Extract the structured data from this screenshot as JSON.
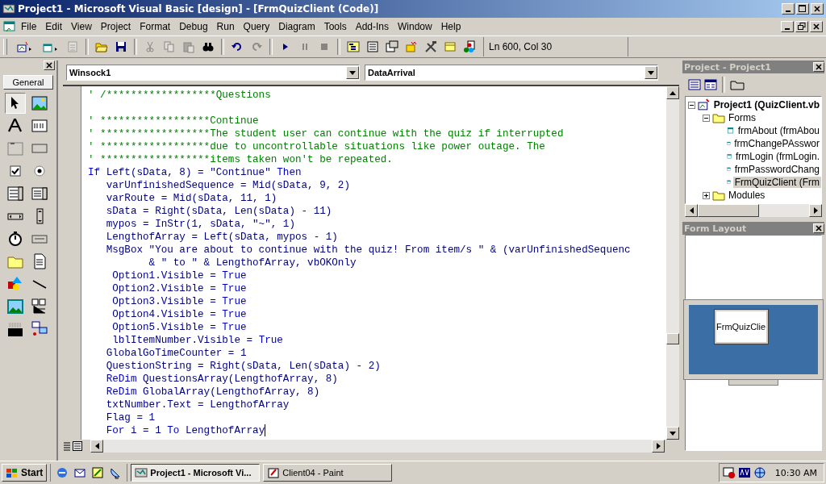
{
  "window": {
    "title": "Project1 - Microsoft Visual Basic [design] - [FrmQuizClient (Code)]"
  },
  "menu": [
    "File",
    "Edit",
    "View",
    "Project",
    "Format",
    "Debug",
    "Run",
    "Query",
    "Diagram",
    "Tools",
    "Add-Ins",
    "Window",
    "Help"
  ],
  "toolbar": {
    "buttons": [
      {
        "disabled": false
      },
      {
        "disabled": false
      },
      {
        "disabled": true
      },
      {
        "disabled": false
      },
      {
        "disabled": false
      },
      {
        "disabled": true
      },
      {
        "disabled": true
      },
      {
        "disabled": true
      },
      {
        "disabled": false
      },
      {
        "disabled": false
      },
      {
        "disabled": true
      },
      {
        "disabled": false
      },
      {
        "disabled": true
      },
      {
        "disabled": true
      },
      {
        "disabled": false
      },
      {
        "disabled": false
      },
      {
        "disabled": false
      },
      {
        "disabled": false
      },
      {
        "disabled": false
      },
      {
        "disabled": false
      },
      {
        "disabled": false
      }
    ],
    "position": "Ln 600, Col 30"
  },
  "toolbox": {
    "tab": "General",
    "tools": [
      {
        "selected": true
      },
      {
        "selected": false
      },
      {
        "selected": false
      },
      {
        "selected": false
      },
      {
        "selected": false
      },
      {
        "selected": false
      },
      {
        "selected": false
      },
      {
        "selected": false
      },
      {
        "selected": false
      },
      {
        "selected": false
      },
      {
        "selected": false
      },
      {
        "selected": false
      },
      {
        "selected": false
      },
      {
        "selected": false
      },
      {
        "selected": false
      },
      {
        "selected": false
      },
      {
        "selected": false
      },
      {
        "selected": false
      },
      {
        "selected": false
      },
      {
        "selected": false
      },
      {
        "selected": false
      },
      {
        "selected": false
      }
    ]
  },
  "code": {
    "object": "Winsock1",
    "procedure": "DataArrival",
    "lines": [
      {
        "kind": "code",
        "tokens": [
          {
            "kind": "comment",
            "text": "' /******************Questions"
          }
        ]
      },
      {
        "kind": "blank"
      },
      {
        "kind": "code",
        "tokens": [
          {
            "kind": "comment",
            "text": "' ******************Continue"
          }
        ]
      },
      {
        "kind": "code",
        "tokens": [
          {
            "kind": "comment",
            "text": "' ******************The student user can continue with the quiz if interrupted"
          }
        ]
      },
      {
        "kind": "code",
        "tokens": [
          {
            "kind": "comment",
            "text": "' ******************due to uncontrollable situations like power outage. The"
          }
        ]
      },
      {
        "kind": "code",
        "tokens": [
          {
            "kind": "comment",
            "text": "' ******************items taken won't be repeated."
          }
        ]
      },
      {
        "kind": "code",
        "tokens": [
          {
            "kind": "keyword",
            "text": "If"
          },
          {
            "kind": "plain",
            "text": " Left(sData, 8) = \"Continue\" "
          },
          {
            "kind": "keyword",
            "text": "Then"
          }
        ]
      },
      {
        "kind": "code",
        "tokens": [
          {
            "kind": "plain",
            "text": "   varUnfinishedSequence = Mid(sData, 9, 2)"
          }
        ]
      },
      {
        "kind": "code",
        "tokens": [
          {
            "kind": "plain",
            "text": "   varRoute = Mid(sData, 11, 1)"
          }
        ]
      },
      {
        "kind": "code",
        "tokens": [
          {
            "kind": "plain",
            "text": "   sData = Right(sData, Len(sData) - 11)"
          }
        ]
      },
      {
        "kind": "code",
        "tokens": [
          {
            "kind": "plain",
            "text": "   mypos = InStr(1, sData, \"~\", 1)"
          }
        ]
      },
      {
        "kind": "code",
        "tokens": [
          {
            "kind": "plain",
            "text": "   LengthofArray = Left(sData, mypos - 1)"
          }
        ]
      },
      {
        "kind": "code",
        "tokens": [
          {
            "kind": "plain",
            "text": "   MsgBox \"You are about to continue with the quiz! From item/s \" & (varUnfinishedSequenc"
          }
        ]
      },
      {
        "kind": "code",
        "tokens": [
          {
            "kind": "plain",
            "text": "          & \" to \" & LengthofArray, vbOKOnly"
          }
        ]
      },
      {
        "kind": "code",
        "tokens": [
          {
            "kind": "plain",
            "text": "    Option1.Visible = "
          },
          {
            "kind": "keyword",
            "text": "True"
          }
        ]
      },
      {
        "kind": "code",
        "tokens": [
          {
            "kind": "plain",
            "text": "    Option2.Visible = "
          },
          {
            "kind": "keyword",
            "text": "True"
          }
        ]
      },
      {
        "kind": "code",
        "tokens": [
          {
            "kind": "plain",
            "text": "    Option3.Visible = "
          },
          {
            "kind": "keyword",
            "text": "True"
          }
        ]
      },
      {
        "kind": "code",
        "tokens": [
          {
            "kind": "plain",
            "text": "    Option4.Visible = "
          },
          {
            "kind": "keyword",
            "text": "True"
          }
        ]
      },
      {
        "kind": "code",
        "tokens": [
          {
            "kind": "plain",
            "text": "    Option5.Visible = "
          },
          {
            "kind": "keyword",
            "text": "True"
          }
        ]
      },
      {
        "kind": "code",
        "tokens": [
          {
            "kind": "plain",
            "text": "    lblItemNumber.Visible = "
          },
          {
            "kind": "keyword",
            "text": "True"
          }
        ]
      },
      {
        "kind": "code",
        "tokens": [
          {
            "kind": "plain",
            "text": "   GlobalGoTimeCounter = 1"
          }
        ]
      },
      {
        "kind": "code",
        "tokens": [
          {
            "kind": "plain",
            "text": "   QuestionString = Right(sData, Len(sData) - 2)"
          }
        ]
      },
      {
        "kind": "code",
        "tokens": [
          {
            "kind": "keyword",
            "text": "   ReDim"
          },
          {
            "kind": "plain",
            "text": " QuestionsArray(LengthofArray, 8)"
          }
        ]
      },
      {
        "kind": "code",
        "tokens": [
          {
            "kind": "keyword",
            "text": "   ReDim"
          },
          {
            "kind": "plain",
            "text": " GlobalArray(LengthofArray, 8)"
          }
        ]
      },
      {
        "kind": "code",
        "tokens": [
          {
            "kind": "plain",
            "text": "   txtNumber.Text = LengthofArray"
          }
        ]
      },
      {
        "kind": "code",
        "tokens": [
          {
            "kind": "plain",
            "text": "   Flag = 1"
          }
        ]
      },
      {
        "kind": "code",
        "caret": true,
        "tokens": [
          {
            "kind": "keyword",
            "text": "   For"
          },
          {
            "kind": "plain",
            "text": " i = 1 "
          },
          {
            "kind": "keyword",
            "text": "To"
          },
          {
            "kind": "plain",
            "text": " LengthofArray"
          }
        ]
      }
    ]
  },
  "project_panel": {
    "title": "Project - Project1",
    "tree": [
      {
        "label": "Project1 (QuizClient.vb",
        "kind": "project",
        "expanded": true,
        "selected": false,
        "children": [
          {
            "label": "Forms",
            "kind": "folder",
            "expanded": true,
            "selected": false,
            "children": [
              {
                "label": "frmAbout (frmAbou",
                "kind": "form",
                "selected": false
              },
              {
                "label": "frmChangePAsswor",
                "kind": "form",
                "selected": false
              },
              {
                "label": "frmLogin (frmLogin.",
                "kind": "form",
                "selected": false
              },
              {
                "label": "frmPasswordChang",
                "kind": "form",
                "selected": false
              },
              {
                "label": "FrmQuizClient (Frm",
                "kind": "form",
                "selected": true
              }
            ]
          },
          {
            "label": "Modules",
            "kind": "folder",
            "expanded": false,
            "selected": false
          }
        ]
      }
    ]
  },
  "form_layout": {
    "title": "Form Layout",
    "form_label": "FrmQuizClie"
  },
  "taskbar": {
    "start": "Start",
    "tasks": [
      {
        "label": "Project1 - Microsoft Vi...",
        "selected": true
      },
      {
        "label": "Client04 - Paint",
        "selected": false
      }
    ],
    "clock": "10:30 AM"
  }
}
